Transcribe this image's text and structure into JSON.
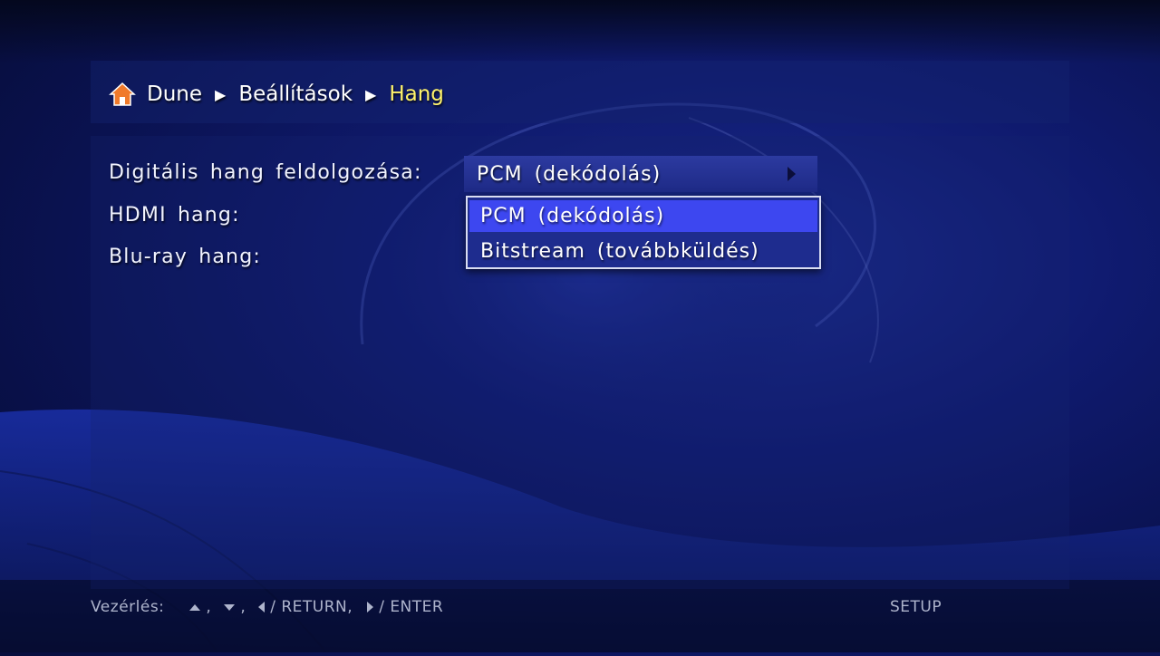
{
  "breadcrumb": {
    "items": [
      "Dune",
      "Beállítások",
      "Hang"
    ],
    "home_icon": "home-icon"
  },
  "settings": [
    {
      "label": "Digitális hang feldolgozása:",
      "value": "PCM (dekódolás)"
    },
    {
      "label": "HDMI hang:",
      "value": ""
    },
    {
      "label": "Blu-ray hang:",
      "value": ""
    }
  ],
  "dropdown": {
    "options": [
      "PCM (dekódolás)",
      "Bitstream (továbbküldés)"
    ],
    "selected_index": 0
  },
  "footer": {
    "controls_label": "Vezérlés:",
    "comma1": ",",
    "comma2": ",",
    "return_text": "/ RETURN,",
    "enter_text": "/ ENTER",
    "setup": "SETUP"
  },
  "colors": {
    "breadcrumb_current": "#fff36b",
    "dropdown_selected": "#3d47f0",
    "value_box": "#2c3aa0"
  }
}
